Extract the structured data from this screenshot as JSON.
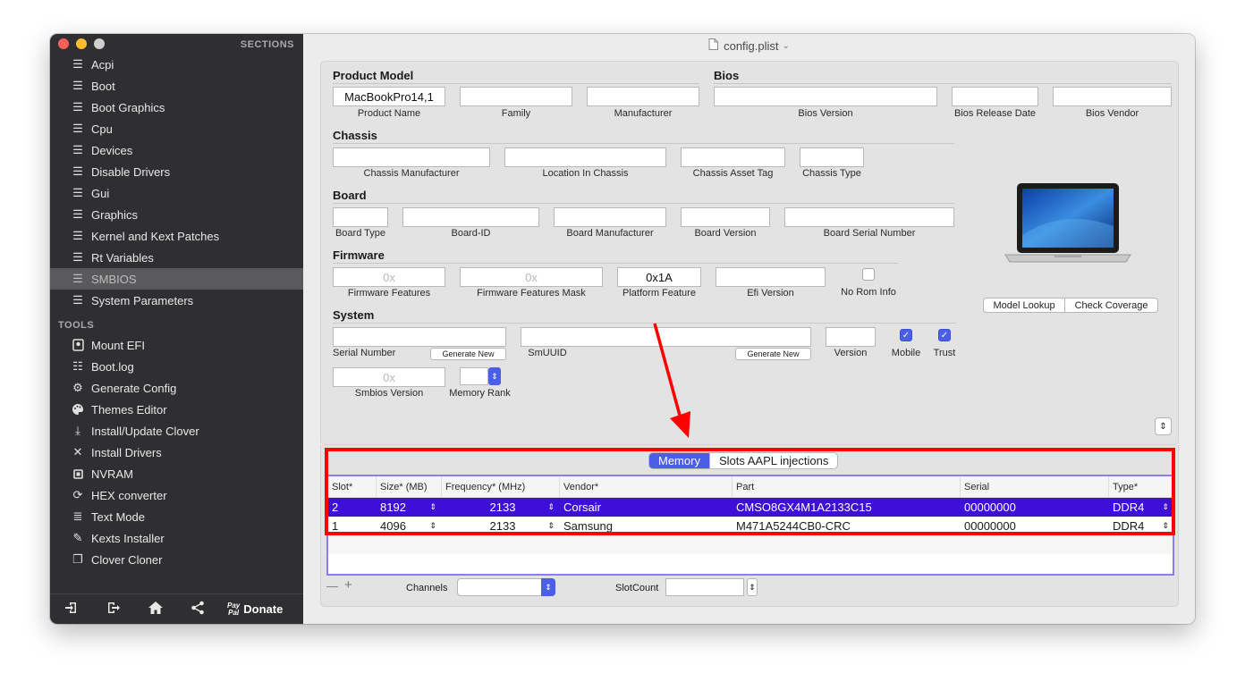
{
  "window": {
    "title": "config.plist"
  },
  "colors": {
    "accent": "#4b5fe6",
    "selected_row": "#3d0fd8",
    "annotation": "#ff0000"
  },
  "sidebar": {
    "sections_title": "SECTIONS",
    "items": [
      {
        "label": "Acpi",
        "icon": "list-icon"
      },
      {
        "label": "Boot",
        "icon": "list-icon"
      },
      {
        "label": "Boot Graphics",
        "icon": "list-icon"
      },
      {
        "label": "Cpu",
        "icon": "list-icon"
      },
      {
        "label": "Devices",
        "icon": "list-icon"
      },
      {
        "label": "Disable Drivers",
        "icon": "list-icon"
      },
      {
        "label": "Gui",
        "icon": "list-icon"
      },
      {
        "label": "Graphics",
        "icon": "list-icon"
      },
      {
        "label": "Kernel and Kext Patches",
        "icon": "list-icon"
      },
      {
        "label": "Rt Variables",
        "icon": "list-icon"
      },
      {
        "label": "SMBIOS",
        "icon": "list-icon"
      },
      {
        "label": "System Parameters",
        "icon": "list-icon"
      }
    ],
    "tools_title": "TOOLS",
    "tools": [
      {
        "label": "Mount EFI",
        "icon": "disk-icon"
      },
      {
        "label": "Boot.log",
        "icon": "log-icon"
      },
      {
        "label": "Generate Config",
        "icon": "gears-icon"
      },
      {
        "label": "Themes Editor",
        "icon": "palette-icon"
      },
      {
        "label": "Install/Update Clover",
        "icon": "download-icon"
      },
      {
        "label": "Install Drivers",
        "icon": "tools-icon"
      },
      {
        "label": "NVRAM",
        "icon": "chip-icon"
      },
      {
        "label": "HEX converter",
        "icon": "refresh-icon"
      },
      {
        "label": "Text Mode",
        "icon": "text-icon"
      },
      {
        "label": "Kexts Installer",
        "icon": "wrench-icon"
      },
      {
        "label": "Clover Cloner",
        "icon": "clone-icon"
      }
    ],
    "donate_label": "Donate",
    "paypal_line1": "Pay",
    "paypal_line2": "Pal"
  },
  "smbios": {
    "product_model_title": "Product Model",
    "bios_title": "Bios",
    "chassis_title": "Chassis",
    "board_title": "Board",
    "firmware_title": "Firmware",
    "system_title": "System",
    "product_name": {
      "label": "Product Name",
      "value": "MacBookPro14,1"
    },
    "family": {
      "label": "Family",
      "value": ""
    },
    "manufacturer": {
      "label": "Manufacturer",
      "value": ""
    },
    "bios_version": {
      "label": "Bios Version",
      "value": ""
    },
    "bios_release_date": {
      "label": "Bios Release Date",
      "value": ""
    },
    "bios_vendor": {
      "label": "Bios Vendor",
      "value": ""
    },
    "chassis_manufacturer": {
      "label": "Chassis Manufacturer",
      "value": ""
    },
    "location_in_chassis": {
      "label": "Location In Chassis",
      "value": ""
    },
    "chassis_asset_tag": {
      "label": "Chassis  Asset Tag",
      "value": ""
    },
    "chassis_type": {
      "label": "Chassis Type",
      "value": ""
    },
    "board_type": {
      "label": "Board Type",
      "value": ""
    },
    "board_id": {
      "label": "Board-ID",
      "value": ""
    },
    "board_manufacturer": {
      "label": "Board Manufacturer",
      "value": ""
    },
    "board_version": {
      "label": "Board Version",
      "value": ""
    },
    "board_serial": {
      "label": "Board Serial Number",
      "value": ""
    },
    "firmware_features": {
      "label": "Firmware Features",
      "placeholder": "0x"
    },
    "firmware_features_mask": {
      "label": "Firmware Features Mask",
      "placeholder": "0x"
    },
    "platform_feature": {
      "label": "Platform Feature",
      "value": "0x1A"
    },
    "efi_version": {
      "label": "Efi Version",
      "value": ""
    },
    "no_rom_info": {
      "label": "No Rom Info",
      "checked": false
    },
    "serial_number": {
      "label": "Serial Number",
      "value": ""
    },
    "generate_new_label": "Generate New",
    "smuuid": {
      "label": "SmUUID",
      "value": ""
    },
    "version": {
      "label": "Version",
      "value": ""
    },
    "mobile": {
      "label": "Mobile",
      "checked": true
    },
    "trust": {
      "label": "Trust",
      "checked": true
    },
    "smbios_version": {
      "label": "Smbios Version",
      "placeholder": "0x"
    },
    "memory_rank": {
      "label": "Memory Rank",
      "value": ""
    },
    "model_lookup_label": "Model Lookup",
    "check_coverage_label": "Check Coverage"
  },
  "memory": {
    "tabs": [
      {
        "label": "Memory",
        "active": true
      },
      {
        "label": "Slots AAPL injections",
        "active": false
      }
    ],
    "columns": [
      "Slot*",
      "Size* (MB)",
      "Frequency* (MHz)",
      "Vendor*",
      "Part",
      "Serial",
      "Type*"
    ],
    "rows": [
      {
        "slot": "2",
        "size": "8192",
        "frequency": "2133",
        "vendor": "Corsair",
        "part": "CMSO8GX4M1A2133C15",
        "serial": "00000000",
        "type": "DDR4",
        "selected": true
      },
      {
        "slot": "1",
        "size": "4096",
        "frequency": "2133",
        "vendor": "Samsung",
        "part": "M471A5244CB0-CRC",
        "serial": "00000000",
        "type": "DDR4",
        "selected": false
      }
    ],
    "channels_label": "Channels",
    "channels_value": "",
    "slotcount_label": "SlotCount",
    "slotcount_value": "",
    "remove_label": "—",
    "add_label": "+"
  }
}
